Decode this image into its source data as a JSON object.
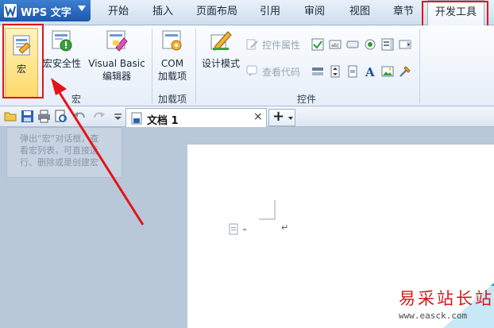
{
  "app": {
    "title": "WPS 文字"
  },
  "tabs": [
    {
      "label": "开始"
    },
    {
      "label": "插入"
    },
    {
      "label": "页面布局"
    },
    {
      "label": "引用"
    },
    {
      "label": "审阅"
    },
    {
      "label": "视图"
    },
    {
      "label": "章节"
    },
    {
      "label": "开发工具"
    }
  ],
  "ribbon": {
    "macro_group": {
      "label": "宏",
      "macro": "宏",
      "security": "宏安全性",
      "vb_line1": "Visual Basic",
      "vb_line2": "编辑器"
    },
    "addins_group": {
      "label": "加载项",
      "com_line1": "COM",
      "com_line2": "加载项"
    },
    "controls_group": {
      "label": "控件",
      "design_mode": "设计模式",
      "properties": "控件属性",
      "view_code": "查看代码"
    }
  },
  "tooltip": {
    "line1": "弹出“宏”对话框，查",
    "line2": "看宏列表，可直接运",
    "line3": "行、删除或是创建宏"
  },
  "document": {
    "tab_label": "文档 1",
    "close_glyph": "×",
    "new_tab_glyph": "+",
    "paragraph_mark": "↵"
  },
  "watermark": {
    "name": "易采站长站",
    "url": "www.easck.com"
  },
  "colors": {
    "highlight": "#e3141a",
    "app_button": "#2563b8",
    "macro_active": "#ffd86a"
  }
}
